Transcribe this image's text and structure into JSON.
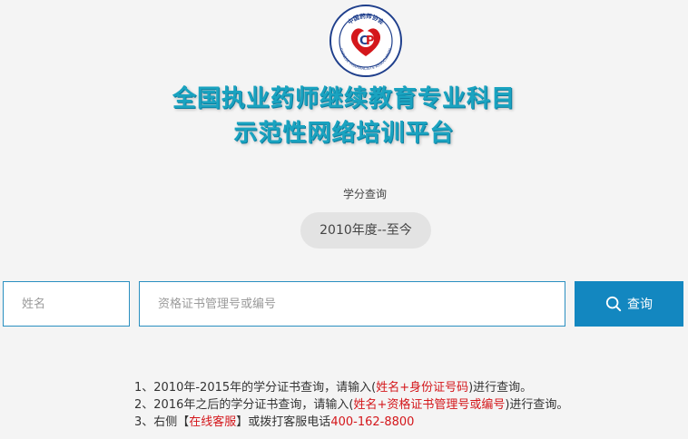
{
  "logo": {
    "org_text_cn": "中国药师协会",
    "org_text_en": "CHINESE PHARMACISTS ASSOCIATION",
    "icon": "association-seal"
  },
  "title": {
    "line1": "全国执业药师继续教育专业科目",
    "line2": "示范性网络培训平台"
  },
  "subtitle": "学分查询",
  "year_range": "2010年度--至今",
  "form": {
    "name_placeholder": "姓名",
    "cert_placeholder": "资格证书管理号或编号",
    "search_label": "查询",
    "search_icon": "search-icon"
  },
  "notes": {
    "n1": {
      "prefix": "1、2010年-2015年的学分证书查询，请输入(",
      "highlight": "姓名+身份证号码",
      "suffix": ")进行查询。"
    },
    "n2": {
      "prefix": "2、2016年之后的学分证书查询，请输入(",
      "highlight": "姓名+资格证书管理号或编号",
      "suffix": ")进行查询。"
    },
    "n3": {
      "prefix": "3、右侧【",
      "highlight": "在线客服",
      "mid": "】或拨打客服电话",
      "phone": "400-162-8800"
    }
  },
  "colors": {
    "accent": "#1387c0",
    "title": "#1aa3c0",
    "highlight": "#d4171b",
    "background": "#f4f4f4"
  }
}
